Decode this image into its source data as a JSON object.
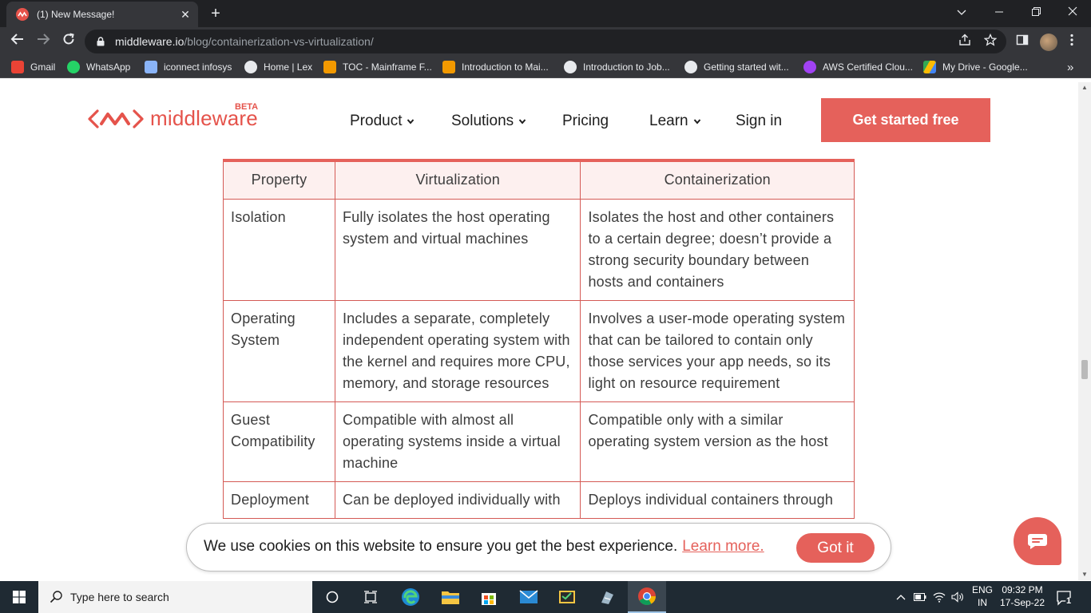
{
  "browser": {
    "tab_title": "(1) New Message!",
    "tab_close": "✕",
    "new_tab": "+",
    "url_host": "middleware.io",
    "url_path": "/blog/containerization-vs-virtualization/",
    "bookmarks": [
      {
        "label": "Gmail",
        "color": "#ea4335"
      },
      {
        "label": "WhatsApp",
        "color": "#25d366"
      },
      {
        "label": "iconnect infosys",
        "color": "#8ab4f8"
      },
      {
        "label": "Home | Lex",
        "color": "#e8eaed"
      },
      {
        "label": "TOC - Mainframe F...",
        "color": "#f29900"
      },
      {
        "label": "Introduction to Mai...",
        "color": "#f29900"
      },
      {
        "label": "Introduction to Job...",
        "color": "#e8eaed"
      },
      {
        "label": "Getting started wit...",
        "color": "#e8eaed"
      },
      {
        "label": "AWS Certified Clou...",
        "color": "#a142f4"
      },
      {
        "label": "My Drive - Google...",
        "color": "#fbbc04"
      }
    ],
    "bookmarks_more": "»"
  },
  "site": {
    "logo_text": "middleware",
    "logo_badge": "BETA",
    "brand_color": "#e5615b",
    "nav": [
      {
        "label": "Product",
        "dropdown": true
      },
      {
        "label": "Solutions",
        "dropdown": true
      },
      {
        "label": "Pricing",
        "dropdown": false
      },
      {
        "label": "Learn",
        "dropdown": true
      },
      {
        "label": "Sign in",
        "dropdown": false
      }
    ],
    "cta_label": "Get started free"
  },
  "table": {
    "headers": [
      "Property",
      "Virtualization",
      "Containerization"
    ],
    "rows": [
      {
        "property": "Isolation",
        "virtualization": "Fully isolates the host operating system and virtual machines",
        "containerization": "Isolates the host and other containers to a certain degree; doesn’t provide a strong security boundary between hosts and containers"
      },
      {
        "property": "Operating System",
        "virtualization": "Includes a separate, completely independent operating system with the kernel and requires more CPU, memory, and storage resources",
        "containerization": "Involves a user-mode operating system that can be tailored to contain only those services your app needs, so its light on resource requirement"
      },
      {
        "property": "Guest Compatibility",
        "virtualization": "Compatible with almost all operating systems inside a virtual machine",
        "containerization": "Compatible only with a similar operating system version as the host"
      },
      {
        "property": "Deployment",
        "virtualization": "Can be deployed individually with",
        "containerization": "Deploys individual containers through"
      }
    ]
  },
  "cookie": {
    "message": "We use cookies on this website to ensure you get the best experience.",
    "learn_more": "Learn more.",
    "button": "Got it"
  },
  "taskbar": {
    "search_placeholder": "Type here to search",
    "lang_line1": "ENG",
    "lang_line2": "IN",
    "time": "09:32 PM",
    "date": "17-Sep-22",
    "notification_count": "1"
  }
}
